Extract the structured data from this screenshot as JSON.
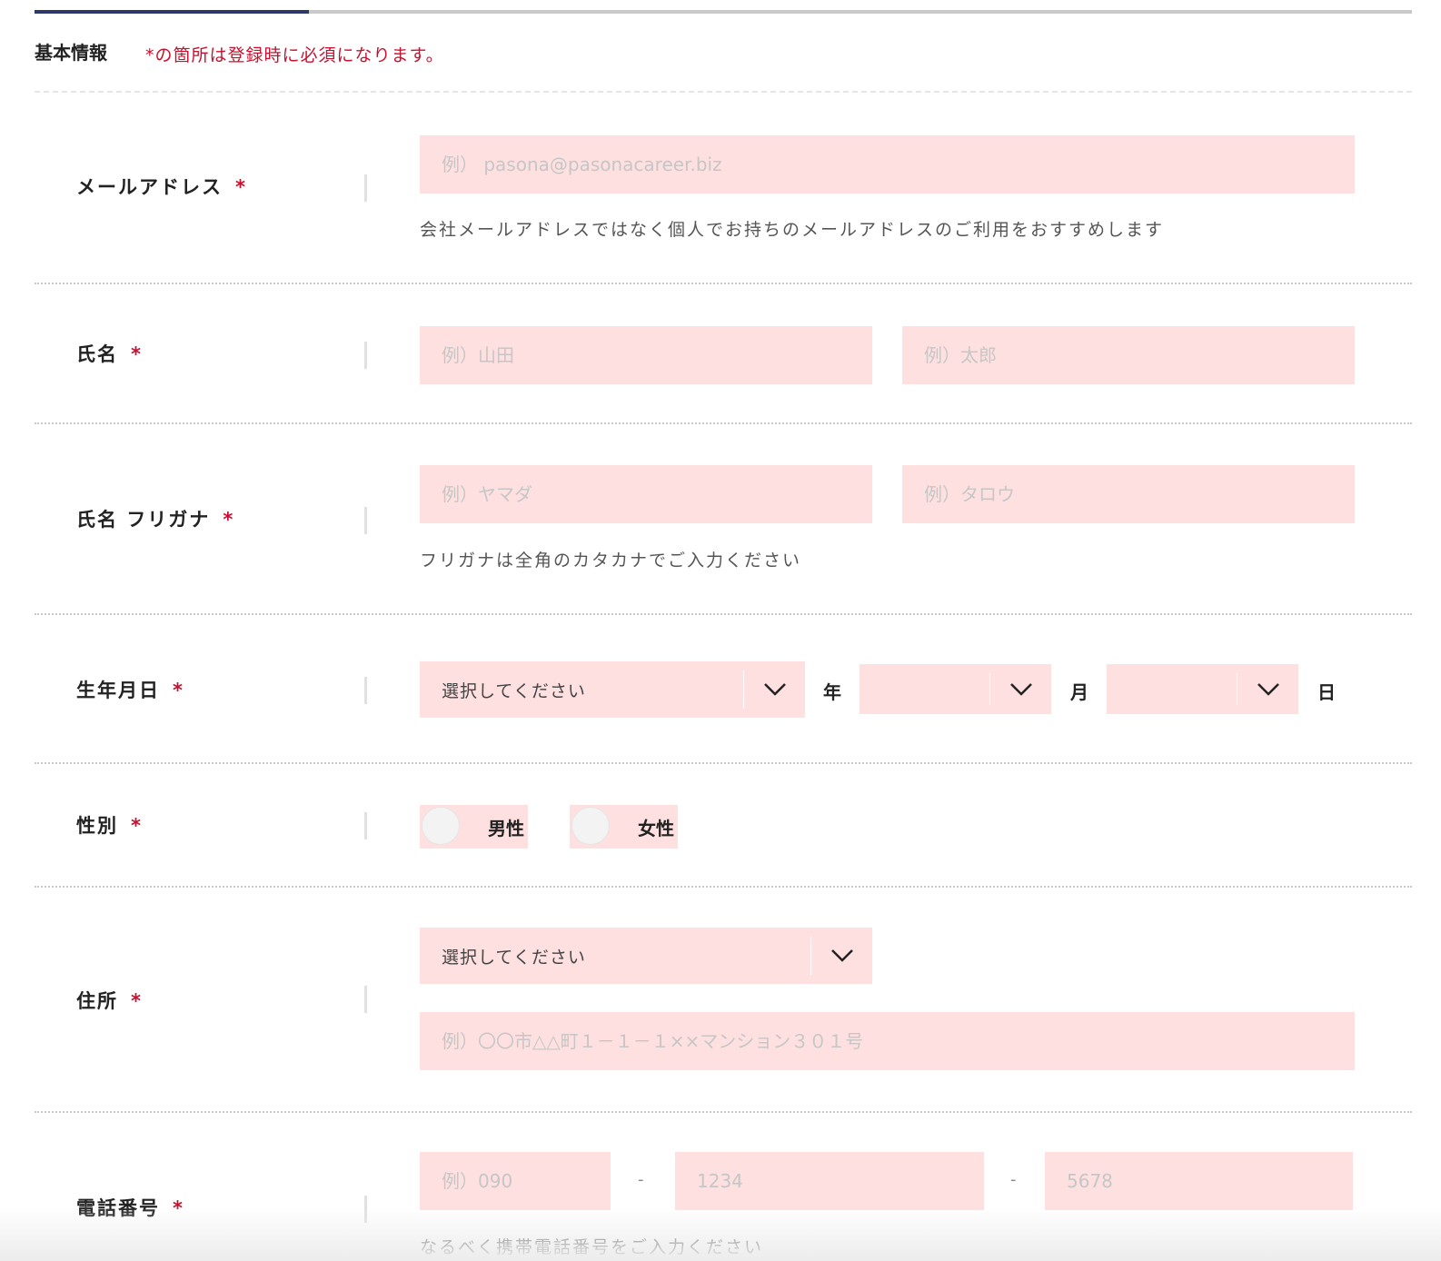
{
  "header": {
    "section_title": "基本情報",
    "required_note": "*の箇所は登録時に必須になります。"
  },
  "form": {
    "required_mark": "*",
    "email": {
      "label": "メールアドレス",
      "placeholder": "例） pasona@pasonacareer.biz",
      "help": "会社メールアドレスではなく個人でお持ちのメールアドレスのご利用をおすすめします"
    },
    "name": {
      "label": "氏名",
      "last_placeholder": "例）山田",
      "first_placeholder": "例）太郎"
    },
    "kana": {
      "label": "氏名 フリガナ",
      "last_placeholder": "例）ヤマダ",
      "first_placeholder": "例）タロウ",
      "help": "フリガナは全角のカタカナでご入力ください"
    },
    "birthday": {
      "label": "生年月日",
      "year_value": "選択してください",
      "year_unit": "年",
      "month_value": "",
      "month_unit": "月",
      "day_value": "",
      "day_unit": "日"
    },
    "gender": {
      "label": "性別",
      "options": [
        "男性",
        "女性"
      ]
    },
    "address": {
      "label": "住所",
      "prefecture_value": "選択してください",
      "detail_placeholder": "例）〇〇市△△町１－１－１××マンション３０１号"
    },
    "phone": {
      "label": "電話番号",
      "part1_placeholder": "例）090",
      "part2_placeholder": "1234",
      "part3_placeholder": "5678",
      "separator": "-",
      "help": "なるべく携帯電話番号をご入力ください"
    }
  },
  "icons": {
    "dropdown": "chevron-down-icon"
  },
  "colors": {
    "accent": "#c8102e",
    "field_bg": "#fde0df",
    "progress": "#2b3a6b"
  }
}
